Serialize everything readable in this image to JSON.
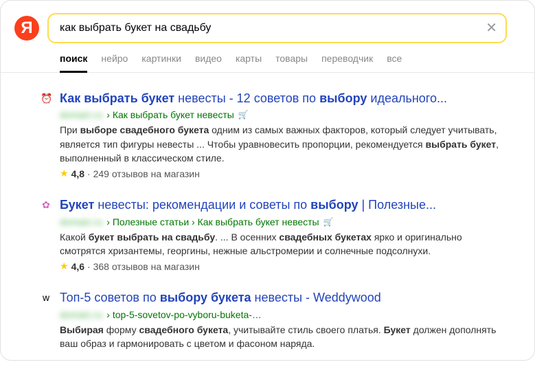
{
  "search": {
    "value": "как выбрать букет на свадьбу"
  },
  "logo": {
    "letter": "Я"
  },
  "tabs": [
    {
      "label": "поиск",
      "active": true
    },
    {
      "label": "нейро",
      "active": false
    },
    {
      "label": "картинки",
      "active": false
    },
    {
      "label": "видео",
      "active": false
    },
    {
      "label": "карты",
      "active": false
    },
    {
      "label": "товары",
      "active": false
    },
    {
      "label": "переводчик",
      "active": false
    },
    {
      "label": "все",
      "active": false
    }
  ],
  "results": [
    {
      "favicon": "⏰",
      "favicon_color": "#f5b8c5",
      "title_html": "<b>Как выбрать букет</b> невесты - 12 советов по <b>выбору</b> идеального...",
      "domain_blurred": "domain.ru",
      "breadcrumb": " › Как выбрать букет невесты",
      "has_cart": true,
      "snippet_html": "При <b>выборе свадебного букета</b> одним из самых важных факторов, который следует учитывать, является тип фигуры невесты ... Чтобы уравновесить пропорции, рекомендуется <b>выбрать букет</b>, выполненный в классическом стиле.",
      "rating": "4,8",
      "reviews": "249 отзывов на магазин"
    },
    {
      "favicon": "✿",
      "favicon_color": "#d666c1",
      "title_html": "<b>Букет</b> невесты: рекомендации и советы по <b>выбору</b> | Полезные...",
      "domain_blurred": "domain.ru",
      "breadcrumb": " › Полезные статьи › Как выбрать букет невесты",
      "has_cart": true,
      "snippet_html": "Какой <b>букет выбрать на свадьбу</b>. ... В осенних <b>свадебных букетах</b> ярко и оригинально смотрятся хризантемы, георгины, нежные альстромерии и солнечные подсолнухи.",
      "rating": "4,6",
      "reviews": "368 отзывов на магазин"
    },
    {
      "favicon": "w",
      "favicon_color": "#000",
      "title_html": "Топ-5 советов по <b>выбору букета</b> невесты - Weddywood",
      "domain_blurred": "domain.ru",
      "breadcrumb": " › top-5-sovetov-po-vyboru-buketa-…",
      "has_cart": false,
      "snippet_html": "<b>Выбирая</b> форму <b>свадебного букета</b>, учитывайте стиль своего платья. <b>Букет</b> должен дополнять ваш образ и гармонировать с цветом и фасоном наряда.",
      "rating": null,
      "reviews": null
    }
  ]
}
